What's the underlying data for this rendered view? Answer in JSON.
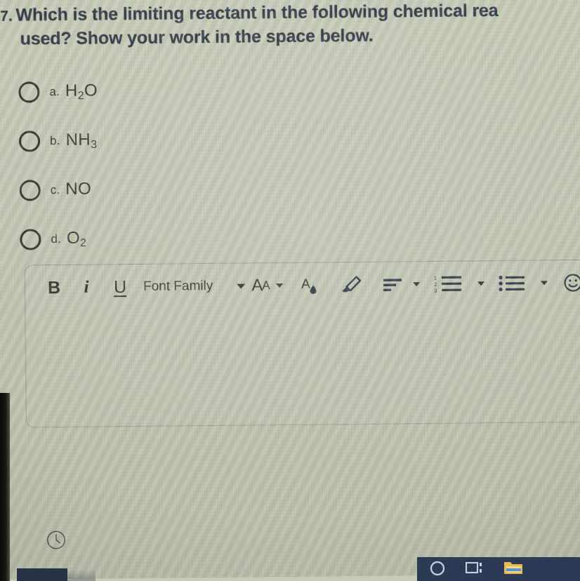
{
  "question": {
    "number": "7.",
    "line1": "Which is the limiting reactant in the following chemical rea",
    "line2": "used? Show your work in the space below."
  },
  "options": [
    {
      "letter": "a.",
      "formula_main": "H",
      "formula_sub": "2",
      "formula_tail": "O",
      "value": "H2O"
    },
    {
      "letter": "b.",
      "formula_main": "NH",
      "formula_sub": "3",
      "formula_tail": "",
      "value": "NH3"
    },
    {
      "letter": "c.",
      "formula_main": "NO",
      "formula_sub": "",
      "formula_tail": "",
      "value": "NO"
    },
    {
      "letter": "d.",
      "formula_main": "O",
      "formula_sub": "2",
      "formula_tail": "",
      "value": "O2"
    }
  ],
  "editor": {
    "bold_label": "B",
    "italic_label": "i",
    "underline_label": "U",
    "font_family_label": "Font Family",
    "font_size_label_big": "A",
    "font_size_label_small": "A",
    "text_color_label": "A",
    "body_text": "",
    "body_placeholder": ""
  },
  "icons": {
    "font_family_caret": "chevron-down-icon",
    "font_size_caret": "chevron-down-icon",
    "text_color": "text-color-icon",
    "highlighter": "highlighter-icon",
    "align": "align-left-icon",
    "align_caret": "chevron-down-icon",
    "numbered_list": "numbered-list-icon",
    "numbered_list_caret": "chevron-down-icon",
    "bullet_list": "bullet-list-icon",
    "bullet_list_caret": "chevron-down-icon",
    "emoji": "smiley-face-icon",
    "clock": "clock-icon",
    "taskbar_search": "cortana-search-icon",
    "taskbar_taskview": "task-view-icon",
    "taskbar_explorer": "file-explorer-icon"
  },
  "colors": {
    "page_background": "#c7cab4",
    "heading_text": "#1d2638",
    "body_text": "#20241b",
    "editor_border": "#9ba08c",
    "taskbar": "#2b3a55",
    "bezel": "#0b0c09"
  }
}
